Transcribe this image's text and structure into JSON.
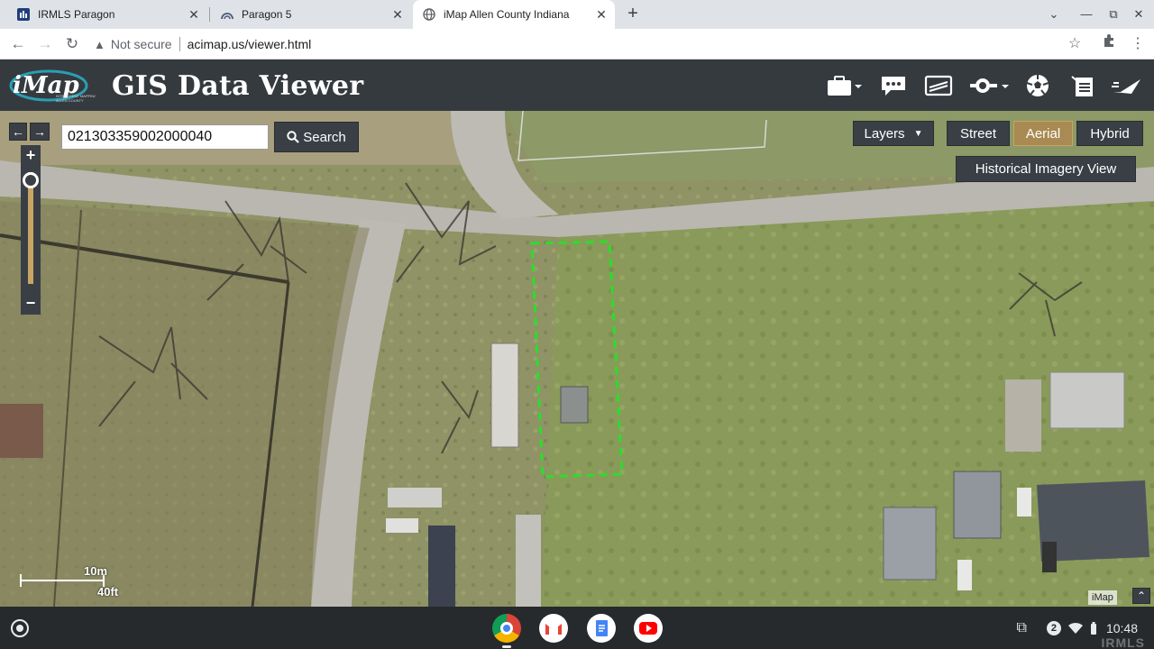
{
  "browser": {
    "tabs": [
      {
        "title": "IRMLS Paragon",
        "favicon": "irmls-icon"
      },
      {
        "title": "Paragon 5",
        "favicon": "paragon-icon"
      },
      {
        "title": "iMap Allen County Indiana",
        "favicon": "globe-icon",
        "active": true
      }
    ],
    "address": {
      "security_label": "Not secure",
      "url": "acimap.us/viewer.html"
    }
  },
  "app": {
    "logo_text": "iMap",
    "logo_subtext": "INTELLIGENT MAPPING",
    "logo_county": "ALLEN COUNTY",
    "title": "GIS Data Viewer",
    "header_icons": [
      "briefcase-icon",
      "comment-icon",
      "layers-card-icon",
      "tools-icon",
      "soccer-ball-icon",
      "clipboard-list-icon",
      "send-icon"
    ]
  },
  "map": {
    "search": {
      "value": "021303359002000040",
      "button_label": "Search"
    },
    "layers_label": "Layers",
    "basemaps": [
      {
        "label": "Street",
        "active": false
      },
      {
        "label": "Aerial",
        "active": true
      },
      {
        "label": "Hybrid",
        "active": false
      }
    ],
    "historical_label": "Historical Imagery View",
    "zoom": {
      "plus": "+",
      "minus": "−",
      "level": 0.98
    },
    "scale": {
      "metric": "10m",
      "imperial": "40ft"
    },
    "attribution": "iMap",
    "accent_color": "#c8a565",
    "parcel_outline_color": "#2ddc2d"
  },
  "shelf": {
    "apps": [
      "chrome-icon",
      "gmail-icon",
      "docs-icon",
      "youtube-icon"
    ],
    "notification_count": "2",
    "time": "10:48",
    "watermark": "IRMLS"
  }
}
